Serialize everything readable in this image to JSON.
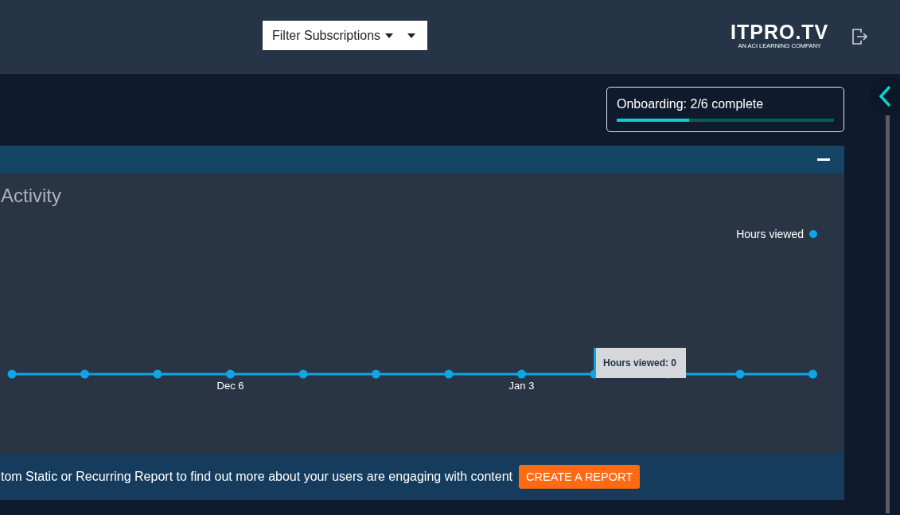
{
  "header": {
    "filter": {
      "label": "Filter Subscriptions"
    },
    "logo": {
      "name": "ITPRO.TV",
      "tagline": "AN ACI LEARNING COMPANY"
    }
  },
  "onboarding": {
    "label": "Onboarding: 2/6 complete",
    "level": 0.333
  },
  "activity_panel": {
    "expanded": true,
    "title": "Activity",
    "x_labels": [
      "Dec 6",
      "Jan 3"
    ],
    "legend": "Hours viewed",
    "tooltip": {
      "label": "Hours viewed: 0"
    },
    "banner": {
      "text": "tom Static or Recurring Report to find out more about your users are engaging with content",
      "button": "CREATE A REPORT"
    }
  }
}
